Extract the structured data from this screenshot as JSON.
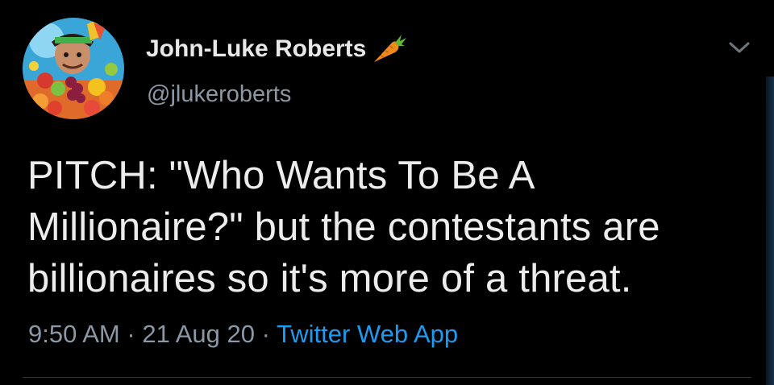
{
  "tweet": {
    "author": {
      "display_name": "John-Luke Roberts",
      "handle": "@jlukeroberts",
      "name_emoji": "carrot-icon"
    },
    "text_lines": [
      "PITCH: \"Who Wants To Be A",
      "Millionaire?\" but the contestants are",
      "billionaires so it's more of a threat."
    ],
    "time": "9:50 AM",
    "separator": "·",
    "date": "21 Aug 20",
    "source": "Twitter Web App"
  },
  "colors": {
    "background": "#000000",
    "text": "#ececec",
    "secondary": "#8b98a5",
    "link": "#1d9bf0",
    "carrot": "#f08a1c"
  }
}
